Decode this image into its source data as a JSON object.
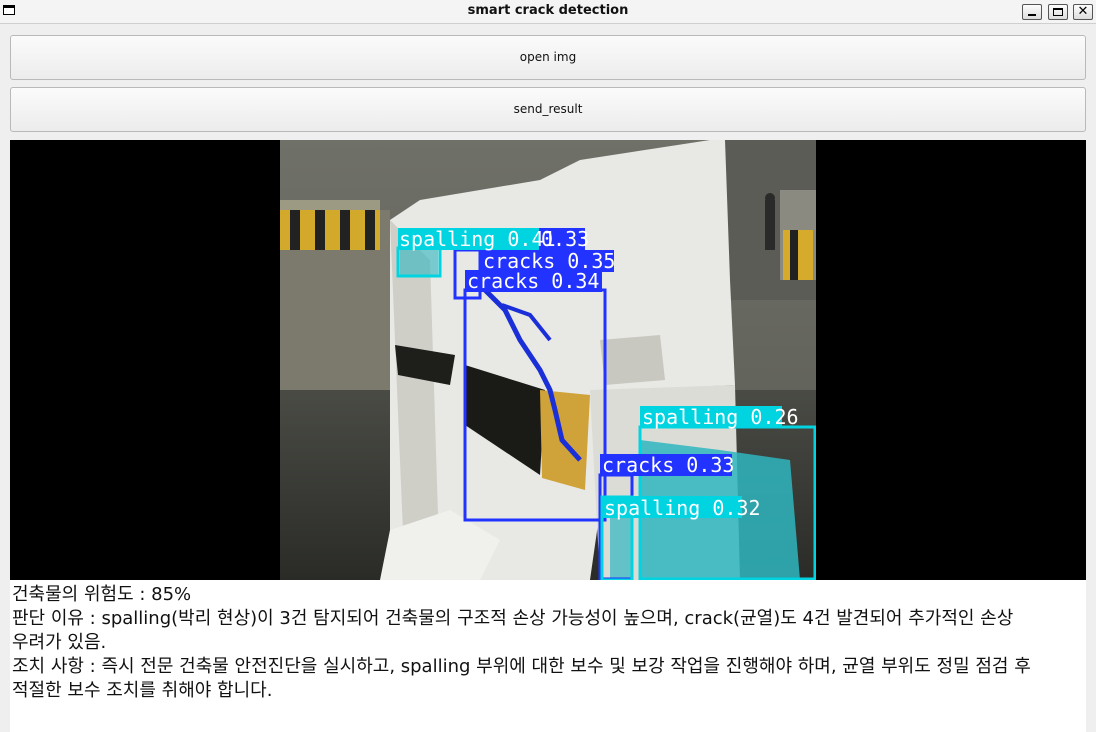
{
  "window": {
    "title": "smart crack detection",
    "controls": [
      "minimize-icon",
      "maximize-icon",
      "close-icon"
    ]
  },
  "buttons": {
    "open_label": "open img",
    "send_label": "send_result"
  },
  "detections": [
    {
      "label": "spalling 0.41",
      "color": "#00d4e0"
    },
    {
      "label": "0.33",
      "color": "#2233ff"
    },
    {
      "label": "cracks 0.35",
      "color": "#2233ff"
    },
    {
      "label": "cracks 0.34",
      "color": "#2233ff"
    },
    {
      "label": "spalling 0.26",
      "color": "#00d4e0"
    },
    {
      "label": "cracks 0.33",
      "color": "#2233ff"
    },
    {
      "label": "spalling 0.32",
      "color": "#00d4e0"
    }
  ],
  "result": {
    "risk": "건축물의 위험도 : 85%",
    "reason_1": "판단 이유 : spalling(박리 현상)이 3건 탐지되어 건축물의 구조적 손상 가능성이 높으며, crack(균열)도 4건 발견되어 추가적인 손상",
    "reason_2": "우려가 있음.",
    "action_1": "조치 사항 : 즉시 전문 건축물 안전진단을 실시하고, spalling 부위에 대한 보수 및 보강 작업을 진행해야 하며, 균열 부위도 정밀 점검 후",
    "action_2": "적절한 보수 조치를 취해야 합니다."
  }
}
